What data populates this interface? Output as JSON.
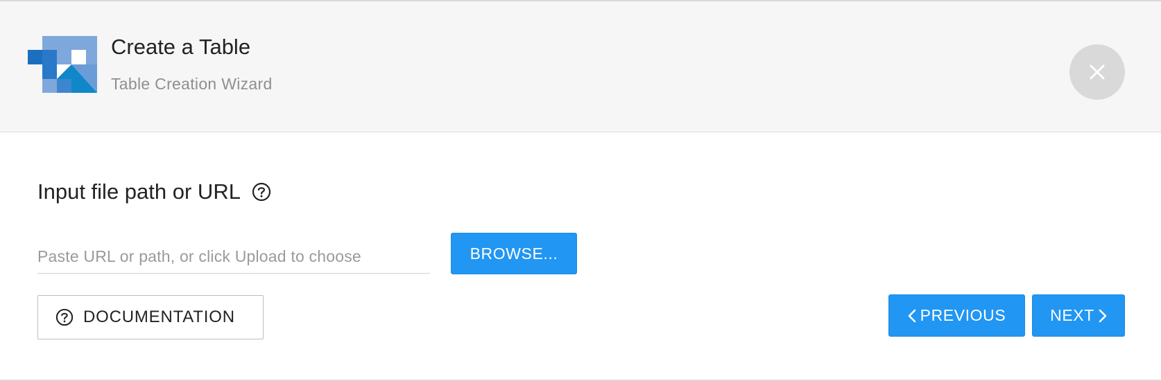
{
  "header": {
    "logo_icon": "table-wizard-logo",
    "title": "Create a Table",
    "subtitle": "Table Creation Wizard",
    "close_icon": "close-icon"
  },
  "form": {
    "heading": "Input file path or URL",
    "help_icon": "help-circle-icon",
    "path_input": {
      "value": "",
      "placeholder": "Paste URL or path, or click Upload to choose"
    },
    "browse_label": "BROWSE..."
  },
  "footer": {
    "documentation_label": "DOCUMENTATION",
    "documentation_icon": "help-circle-icon",
    "previous_label": "PREVIOUS",
    "previous_icon": "chevron-left-icon",
    "next_label": "NEXT",
    "next_icon": "chevron-right-icon"
  },
  "colors": {
    "accent": "#2196f3",
    "header_bg": "#f6f6f6",
    "close_bg": "#d9d9d9",
    "logo_dark": "#1c6fc0",
    "logo_mid": "#4a8fd3",
    "logo_light": "#7ea8dc",
    "logo_teal": "#0f87c9"
  }
}
